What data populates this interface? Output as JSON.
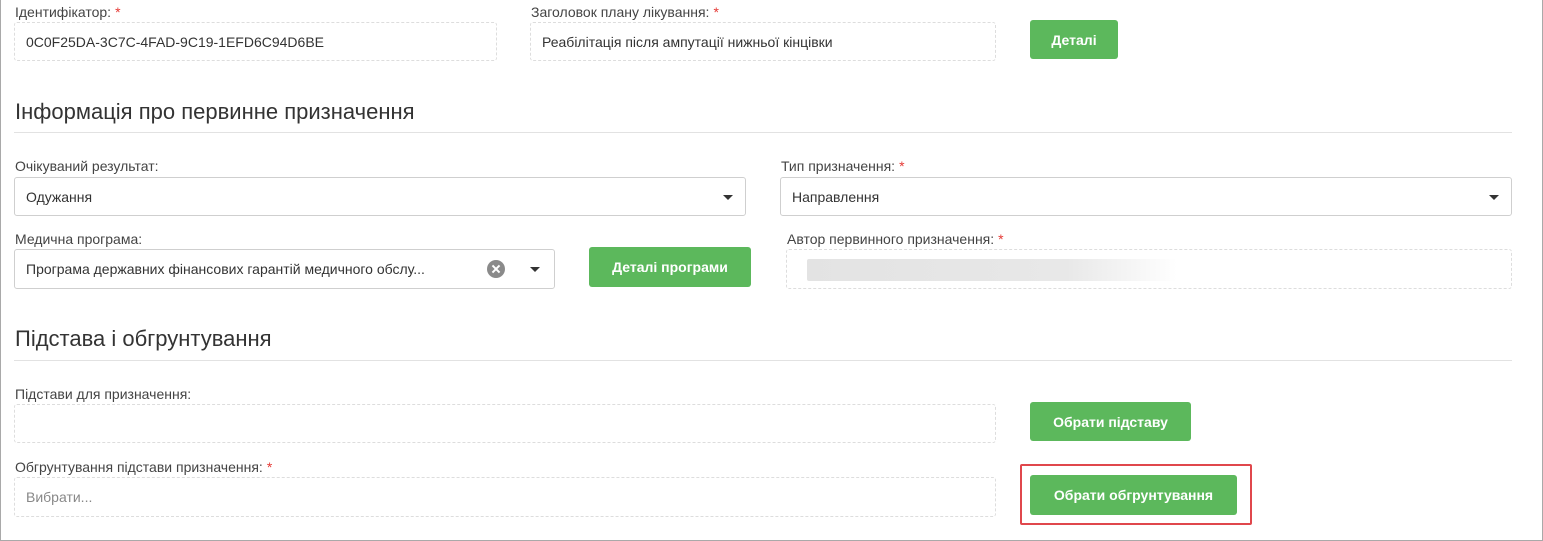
{
  "header": {
    "identifier": {
      "label": "Ідентифікатор:",
      "required": "*",
      "value": "0C0F25DA-3C7C-4FAD-9C19-1EFD6C94D6BE"
    },
    "plan_title": {
      "label": "Заголовок плану лікування:",
      "required": "*",
      "value": "Реабілітація після ампутації нижньої кінцівки"
    },
    "details_button": "Деталі"
  },
  "primary_assignment": {
    "title": "Інформація про первинне призначення",
    "expected_result": {
      "label": "Очікуваний результат:",
      "value": "Одужання"
    },
    "assignment_type": {
      "label": "Тип призначення:",
      "required": "*",
      "value": "Направлення"
    },
    "medical_program": {
      "label": "Медична програма:",
      "value": "Програма державних фінансових гарантій медичного обслу..."
    },
    "program_details_button": "Деталі програми",
    "author": {
      "label": "Автор первинного призначення:",
      "required": "*"
    }
  },
  "basis": {
    "title": "Підстава і обгрунтування",
    "reasons": {
      "label": "Підстави для призначення:",
      "value": ""
    },
    "choose_reason_button": "Обрати підставу",
    "justification": {
      "label": "Обгрунтування підстави призначення:",
      "required": "*",
      "placeholder": "Вибрати..."
    },
    "choose_justification_button": "Обрати обгрунтування"
  },
  "colors": {
    "button_green": "#5cb85c",
    "required_red": "#e53935",
    "highlight_red": "#e0474c"
  }
}
